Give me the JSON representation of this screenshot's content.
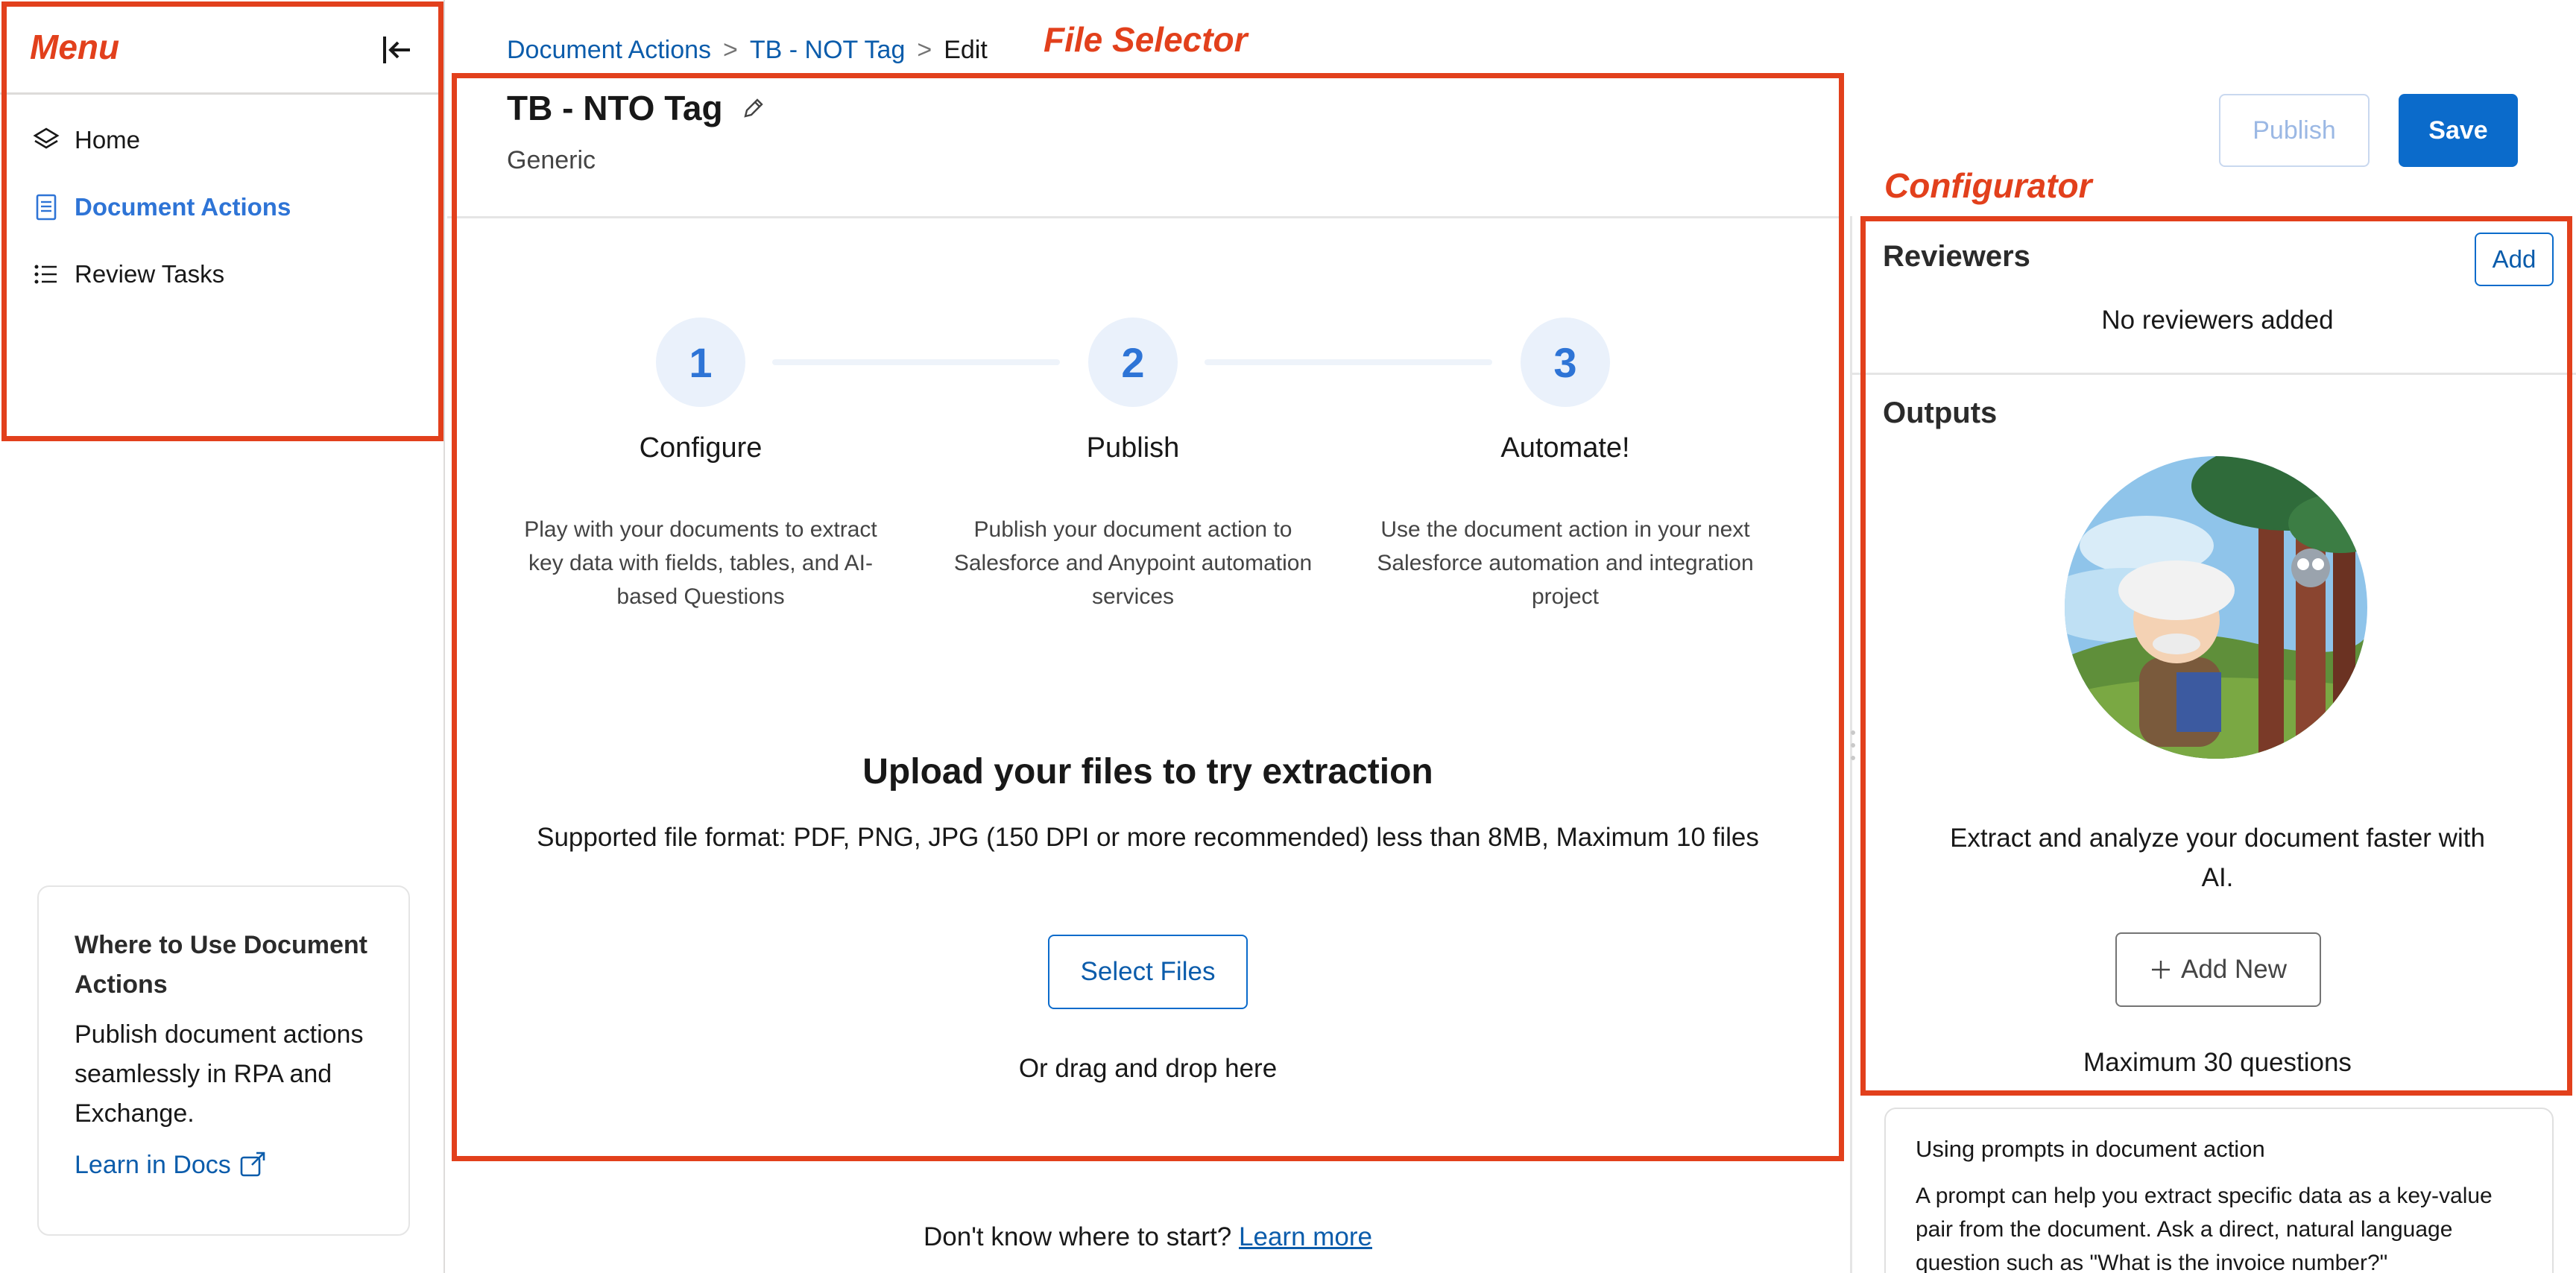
{
  "annotations": {
    "menu": "Menu",
    "file_selector": "File Selector",
    "configurator": "Configurator"
  },
  "sidebar": {
    "items": [
      {
        "label": "Home",
        "icon": "layers-icon",
        "active": false
      },
      {
        "label": "Document Actions",
        "icon": "document-icon",
        "active": true
      },
      {
        "label": "Review Tasks",
        "icon": "list-icon",
        "active": false
      }
    ],
    "card": {
      "title": "Where to Use Document Actions",
      "body": "Publish document actions seamlessly in RPA and Exchange.",
      "link": "Learn in Docs"
    }
  },
  "breadcrumb": {
    "items": [
      "Document Actions",
      "TB - NOT Tag"
    ],
    "current": "Edit"
  },
  "header": {
    "title": "TB - NTO Tag",
    "subtitle": "Generic",
    "publish_label": "Publish",
    "save_label": "Save"
  },
  "steps": [
    {
      "number": "1",
      "title": "Configure",
      "desc": "Play with your documents to extract key data with fields, tables, and AI-based Questions"
    },
    {
      "number": "2",
      "title": "Publish",
      "desc": "Publish your document action to Salesforce and Anypoint automation services"
    },
    {
      "number": "3",
      "title": "Automate!",
      "desc": "Use the document action in your next Salesforce automation and integration project"
    }
  ],
  "upload": {
    "title": "Upload your files to try extraction",
    "subtitle": "Supported file format: PDF, PNG, JPG (150 DPI or more recommended) less than 8MB, Maximum 10 files",
    "button": "Select Files",
    "drag": "Or drag and drop here"
  },
  "hint": {
    "text": "Don't know where to start?",
    "link": "Learn more"
  },
  "reviewers": {
    "heading": "Reviewers",
    "add_label": "Add",
    "empty": "No reviewers added"
  },
  "outputs": {
    "heading": "Outputs",
    "text": "Extract and analyze your document faster with AI.",
    "add_new": "Add New",
    "max": "Maximum 30 questions"
  },
  "prompt_card": {
    "title": "Using prompts in document action",
    "body": "A prompt can help you extract specific data as a key-value pair from the document. Ask a direct, natural language question such as \"What is the invoice number?\""
  },
  "colors": {
    "accent": "#0b6bcb",
    "annotation": "#e2401c"
  }
}
